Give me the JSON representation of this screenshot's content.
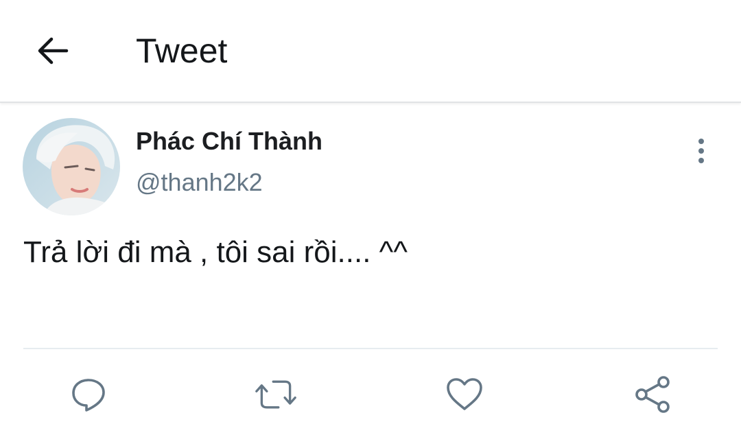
{
  "header": {
    "title": "Tweet",
    "back_icon": "arrow-left-icon"
  },
  "tweet": {
    "author": {
      "name": "Phác Chí Thành",
      "handle": "@thanh2k2"
    },
    "text": "Trả lời đi mà , tôi sai rồi.... ^^",
    "more_icon": "more-vertical-icon"
  },
  "actions": [
    {
      "icon": "reply-icon"
    },
    {
      "icon": "retweet-icon"
    },
    {
      "icon": "like-icon"
    },
    {
      "icon": "share-icon"
    }
  ],
  "colors": {
    "text_primary": "#14171a",
    "text_secondary": "#657786",
    "icon": "#657786",
    "divider": "#e6ecf0"
  }
}
